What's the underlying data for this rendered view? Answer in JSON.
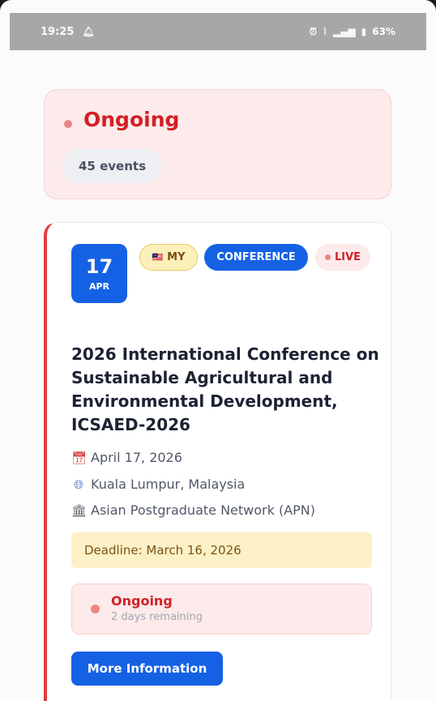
{
  "status_bar": {
    "time": "19:25",
    "notification_icon": "notification-bell-icon",
    "alarm_icon": "alarm-icon",
    "wifi_icon": "wifi-icon",
    "signal_icon": "signal-icon",
    "battery_icon": "battery-icon",
    "battery": "63%"
  },
  "summary": {
    "title": "Ongoing",
    "count": "45 events"
  },
  "event": {
    "day": "17",
    "month": "APR",
    "country": "MY",
    "flag": "🇲🇾",
    "type": "CONFERENCE",
    "live": "LIVE",
    "title": "2026 International Conference on Sustainable Agricultural and Environmental Development, ICSAED-2026",
    "date": "April 17, 2026",
    "location": "Kuala Lumpur, Malaysia",
    "organizer": "Asian Postgraduate Network (APN)",
    "deadline": "Deadline: March 16, 2026",
    "status": "Ongoing",
    "remaining": "2 days remaining",
    "button": "More Information"
  },
  "colors": {
    "accent_blue": "#1561e4",
    "status_red": "#d31f26",
    "ongoing_bg": "#fdeaea",
    "deadline_bg": "#fcf0c6"
  }
}
